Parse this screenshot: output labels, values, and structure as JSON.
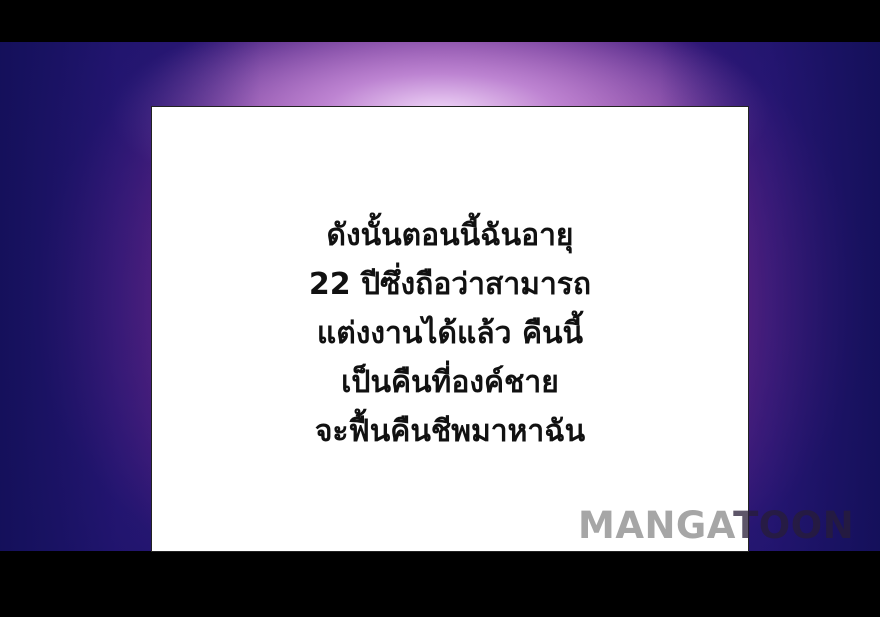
{
  "caption": {
    "lines": [
      "ดังนั้นตอนนี้ฉันอายุ",
      "22 ปีซึ่งถือว่าสามารถ",
      "แต่งงานได้แล้ว คืนนี้",
      "เป็นคืนที่องค์ชาย",
      "จะฟื้นคืนชีพมาหาฉัน"
    ]
  },
  "watermark": {
    "part1": "MANGA",
    "part2": "TOON"
  },
  "colors": {
    "letterbox": "#000000",
    "caption_bg": "#ffffff",
    "caption_text": "#111111",
    "glow": "#e65a8a",
    "backdrop": "#1e1468"
  }
}
